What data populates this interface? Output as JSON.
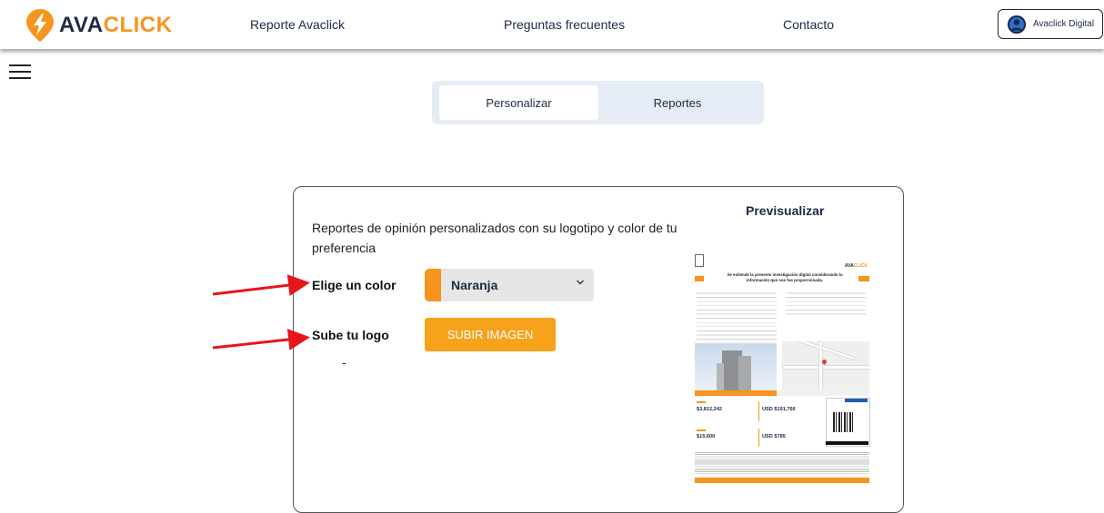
{
  "header": {
    "logo": {
      "part1": "AVA",
      "part2": "CLICK"
    },
    "nav": [
      {
        "label": "Reporte Avaclick"
      },
      {
        "label": "Preguntas frecuentes"
      },
      {
        "label": "Contacto"
      }
    ],
    "user": {
      "label": "Avaclick Digital"
    }
  },
  "tabs": [
    {
      "label": "Personalizar",
      "active": true
    },
    {
      "label": "Reportes",
      "active": false
    }
  ],
  "card": {
    "description": "Reportes de opinión personalizados con su logotipo y color de tu preferencia",
    "color_label": "Elige un color",
    "color_value": "Naranja",
    "color_hex": "#f7941d",
    "logo_label": "Sube tu logo",
    "upload_button": "SUBIR IMAGEN",
    "dash": "-",
    "preview_title": "Previsualizar"
  },
  "colors": {
    "accent": "#f7941d",
    "navy": "#1c2a44",
    "tabs_bg": "#e6ecf5",
    "arrow": "#e8141b"
  },
  "icons": [
    "menu-icon",
    "user-avatar-icon",
    "chevron-down-icon",
    "logo-icon"
  ],
  "report_preview": {
    "headline": "Se extiende la presente investigación digital considerando la información que nos fue proporcionada.",
    "brand": {
      "part1": "AVA",
      "part2": "CLICK"
    },
    "prices": [
      "$3,812,242",
      "USD $191,766",
      "$15,600",
      "USD $785"
    ]
  }
}
